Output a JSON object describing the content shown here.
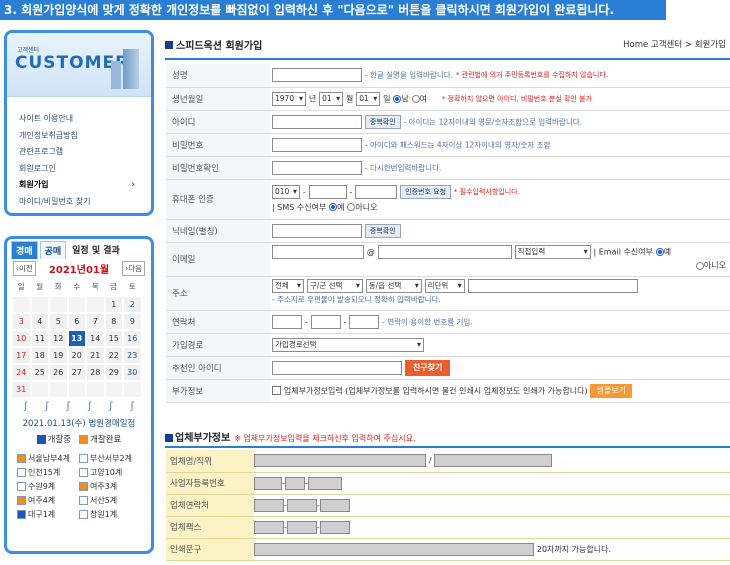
{
  "banner": "3. 회원가입양식에 맞게 정확한 개인정보를 빠짐없이 입력하신 후 \"다음으로\" 버튼을 클릭하시면 회원가입이 완료됩니다.",
  "customer": {
    "small": "고객센터",
    "big": "CUSTOMER",
    "menu": [
      "사이트 이용안내",
      "개인정보취급방침",
      "관련프로그램",
      "회원로그인",
      "회원가입",
      "아이디/비밀번호 찾기"
    ],
    "active_arrow": "›"
  },
  "calendar": {
    "tabs": [
      "경매",
      "공매",
      "일정 및 결과"
    ],
    "prev": "이전",
    "next": "다음",
    "prev_arrow": "‹",
    "next_arrow": "›",
    "month": "2021년01월",
    "days": [
      "일",
      "월",
      "화",
      "수",
      "목",
      "금",
      "토"
    ],
    "weeks": [
      [
        "",
        "",
        "",
        "",
        "",
        "1",
        "2"
      ],
      [
        "3",
        "4",
        "5",
        "6",
        "7",
        "8",
        "9"
      ],
      [
        "10",
        "11",
        "12",
        "13",
        "14",
        "15",
        "16"
      ],
      [
        "17",
        "18",
        "19",
        "20",
        "21",
        "22",
        "23"
      ],
      [
        "24",
        "25",
        "26",
        "27",
        "28",
        "29",
        "30"
      ],
      [
        "31",
        "",
        "",
        "",
        "",
        "",
        ""
      ]
    ],
    "today": "13",
    "date_line": "2021.01.13(수) 법원경매일정",
    "legend": [
      {
        "label": "개찰중",
        "color": "#1d56b8"
      },
      {
        "label": "개찰완료",
        "color": "#f28c1e"
      }
    ],
    "courts": [
      {
        "name": "서울남부4계",
        "color": "#f28c1e"
      },
      {
        "name": "부산서부2계",
        "color": "#ffffff"
      },
      {
        "name": "인천15계",
        "color": "#ffffff"
      },
      {
        "name": "고양10계",
        "color": "#ffffff"
      },
      {
        "name": "수원9계",
        "color": "#ffffff"
      },
      {
        "name": "여주3계",
        "color": "#f28c1e"
      },
      {
        "name": "여주4계",
        "color": "#f28c1e"
      },
      {
        "name": "서산5계",
        "color": "#ffffff"
      },
      {
        "name": "대구1계",
        "color": "#1d56b8"
      },
      {
        "name": "창원1계",
        "color": "#ffffff"
      }
    ]
  },
  "main": {
    "title": "스피드옥션 회원가입",
    "breadcrumb": "Home 고객센터 > 회원가입",
    "fields": {
      "name": {
        "label": "성명",
        "hint": "- 한글 실명을 입력바랍니다.",
        "warn": "* 관련법에 의거 주민등록번호를 수집하지 않습니다."
      },
      "birth": {
        "label": "생년월일",
        "year": "1970",
        "year_unit": "년",
        "month": "01",
        "month_unit": "월",
        "day": "01",
        "day_unit": "일",
        "male": "남",
        "female": "여",
        "warn": "* 정확하지 않으면 아이디, 비밀번호 분실 확인 불가"
      },
      "userid": {
        "label": "아이디",
        "btn": "중복확인",
        "hint": "- 아이디는 12자이내의 영문/숫자조합으로 입력바랍니다."
      },
      "password": {
        "label": "비밀번호",
        "hint": "- 아이디와 패스워드는 4자이상 12자이내의 영자/숫자 조합"
      },
      "password_confirm": {
        "label": "비밀번호확인",
        "hint": "- 다시한번입력바랍니다."
      },
      "phone": {
        "label": "휴대폰 인증",
        "prefix": "010",
        "dash": "-",
        "btn": "인증번호 요청",
        "warn": "* 필수입력사항입니다.",
        "sms_label": "| SMS 수신여부",
        "yes": "예",
        "no": "아니오"
      },
      "nickname": {
        "label": "닉네임(별칭)",
        "btn": "중복확인"
      },
      "email": {
        "label": "이메일",
        "at": "@",
        "direct": "직접입력",
        "recv_label": "| Email 수신여부",
        "yes": "예",
        "no": "아니오"
      },
      "address": {
        "label": "주소",
        "sel1": "전체",
        "sel2": "구/군 선택",
        "sel3": "동/읍 선택",
        "sel4": "리단위",
        "hint": "- 주소지로 우편물이 발송되오니 정확히 입력바랍니다."
      },
      "contact": {
        "label": "연락처",
        "dash": "-",
        "hint": "- 연락이 용이한 번호를 기입."
      },
      "route": {
        "label": "가입경로",
        "placeholder": "가입경로선택"
      },
      "recommender": {
        "label": "추천인 아이디",
        "btn": "친구찾기"
      },
      "extra": {
        "label": "부가정보",
        "text": "업체부가정보입력 (업체부가정보를 입력하시면 물건 인쇄시 업체정보도 인쇄가 가능합니다)",
        "btn": "샘플보기"
      }
    }
  },
  "business": {
    "title": "업체부가정보",
    "warn": "※ 업체부가정보입력을 체크하신후 입력하여 주십시요.",
    "rows": {
      "name": "업체명/직위",
      "slash": "/",
      "regno": "사업자등록번호",
      "contact": "업체연락처",
      "fax": "업체팩스",
      "print": "인쇄문구",
      "print_hint": "20자까지 가능합니다.",
      "dash": "-"
    }
  }
}
